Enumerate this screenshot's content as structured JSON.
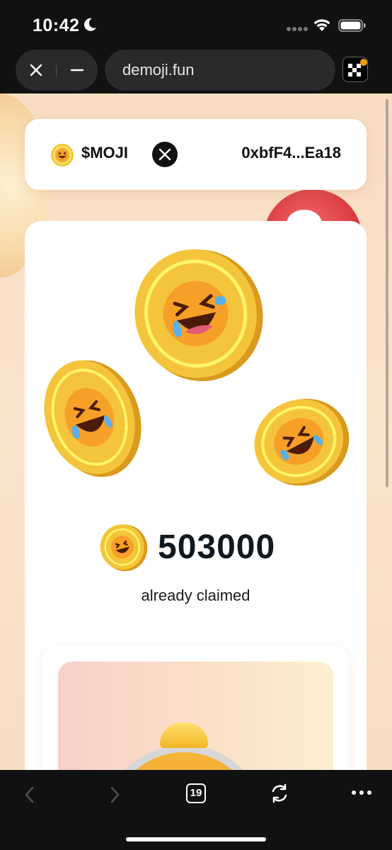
{
  "status_bar": {
    "time": "10:42",
    "icons": [
      "moon-icon",
      "signal-dots-icon",
      "wifi-icon",
      "battery-icon"
    ]
  },
  "browser": {
    "url": "demoji.fun",
    "buttons": [
      "close-icon",
      "minimize-icon",
      "okx-wallet-icon"
    ]
  },
  "header": {
    "ticker": "$MOJI",
    "x_link_icon": "x-logo-icon",
    "wallet_address": "0xbfF4...Ea18"
  },
  "claim": {
    "amount": "503000",
    "status_text": "already claimed"
  },
  "bottom_nav": {
    "tab_count": "19",
    "icons": [
      "back-icon",
      "forward-icon",
      "tabs-icon",
      "refresh-icon",
      "more-icon"
    ]
  },
  "colors": {
    "background": "#fbe4cd",
    "coin_gold": "#f4c53a",
    "emoji_face": "#f7a028",
    "text_dark": "#101820"
  }
}
